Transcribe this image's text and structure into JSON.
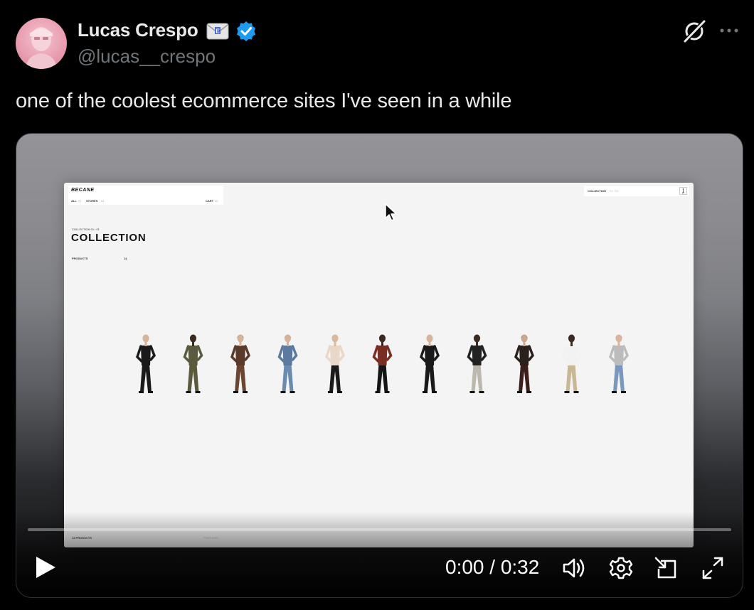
{
  "author": {
    "name": "Lucas Crespo",
    "handle": "@lucas__crespo",
    "verified": true
  },
  "tweet": {
    "text": "one of the coolest ecommerce sites I've seen in a while"
  },
  "icons": [
    "mail-icon",
    "verified-badge-icon",
    "grok-icon",
    "more-icon",
    "play-icon",
    "volume-icon",
    "settings-icon",
    "pip-icon",
    "fullscreen-icon",
    "cursor-icon"
  ],
  "colors": {
    "accent": "#1d9bf0",
    "background": "#000000",
    "text": "#e7e9ea",
    "muted": "#71767b"
  },
  "video": {
    "progress": 0,
    "time": "0:00 / 0:32",
    "frame": {
      "site_logo": "BECANE",
      "nav": {
        "all": "ALL",
        "all_count": "01",
        "stores": "STORES",
        "stores_count": "04",
        "cart": "CART",
        "cart_count": "00"
      },
      "right_bar": {
        "label": "COLLECTION",
        "count": "01 / 01"
      },
      "collection_sub": "COLLECTION 01 / 01",
      "collection_title": "COLLECTION",
      "products_label": "PRODUCTS",
      "products_count": "14",
      "footer_label": "14 PRODUCTS",
      "footer_sort": "FEATURED",
      "models": [
        {
          "top": "#1a1a1a",
          "bottom": "#1a1a1a",
          "skin": "#d9b49a",
          "hair": "#c9a36a"
        },
        {
          "top": "#5a5a3c",
          "bottom": "#5a5a3c",
          "skin": "#3a2a22",
          "hair": "#111111"
        },
        {
          "top": "#5b3a2a",
          "bottom": "#6b4532",
          "skin": "#d8b39a",
          "hair": "#3a2a1e"
        },
        {
          "top": "#5a7aa0",
          "bottom": "#6a8ab0",
          "skin": "#d7b19a",
          "hair": "#8a6a4a"
        },
        {
          "top": "#e9d8c8",
          "bottom": "#1a1a1a",
          "skin": "#dcb89e",
          "hair": "#b08a5a"
        },
        {
          "top": "#7a2e22",
          "bottom": "#151515",
          "skin": "#3a2a22",
          "hair": "#111111"
        },
        {
          "top": "#1a1a1a",
          "bottom": "#1a1a1a",
          "skin": "#d9b49a",
          "hair": "#d9b878"
        },
        {
          "top": "#222222",
          "bottom": "#bdb8ad",
          "skin": "#3a2a22",
          "hair": "#111111"
        },
        {
          "top": "#2a211c",
          "bottom": "#3a1f1a",
          "skin": "#cfa78c",
          "hair": "#4a3426"
        },
        {
          "top": "#f2f2f2",
          "bottom": "#c9b895",
          "skin": "#3a2a22",
          "hair": "#111111"
        },
        {
          "top": "#bcbcbc",
          "bottom": "#7a98bd",
          "skin": "#dbb69c",
          "hair": "#9a7a5a"
        }
      ]
    }
  }
}
